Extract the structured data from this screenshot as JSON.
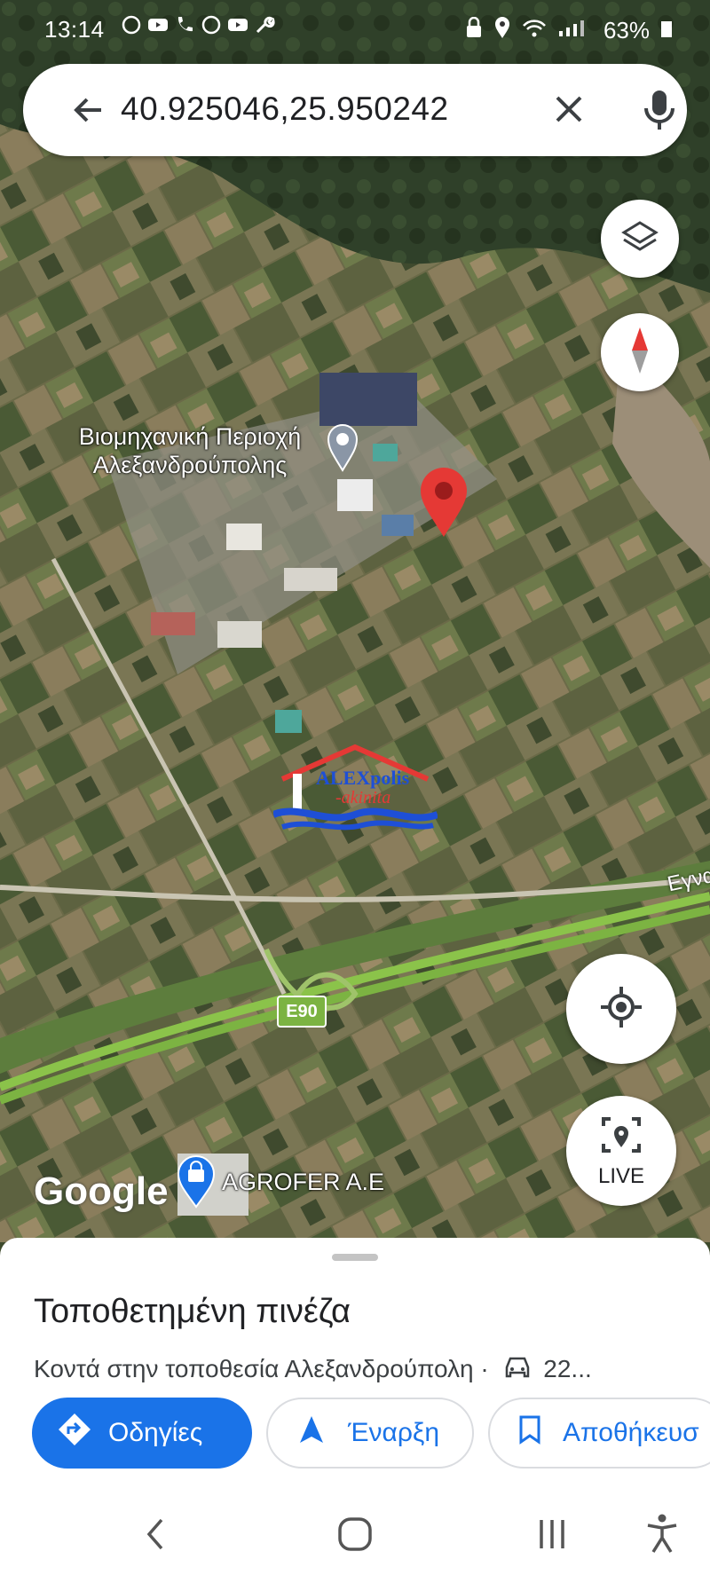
{
  "status_bar": {
    "time": "13:14",
    "battery": "63%"
  },
  "search": {
    "query": "40.925046,25.950242"
  },
  "map": {
    "poi_industrial": "Βιομηχανική Περιοχή\nΑλεξανδρούπολης",
    "poi_agrofer": "AGROFER A.E",
    "road_shield": "E90",
    "road_label": "Εγνα",
    "watermark_line1": "ALEXpolis",
    "watermark_line2": "-akinita",
    "google_logo": "Google",
    "live_label": "LIVE",
    "pin_color": "#e53935",
    "road_color": "#7cb342"
  },
  "sheet": {
    "title": "Τοποθετημένη πινέζα",
    "subtitle": "Κοντά στην τοποθεσία Αλεξανδρούπολη ·",
    "drive_time": "22...",
    "buttons": {
      "directions": "Οδηγίες",
      "start": "Έναρξη",
      "save": "Αποθήκευσ"
    }
  },
  "colors": {
    "primary": "#1a73e8"
  }
}
